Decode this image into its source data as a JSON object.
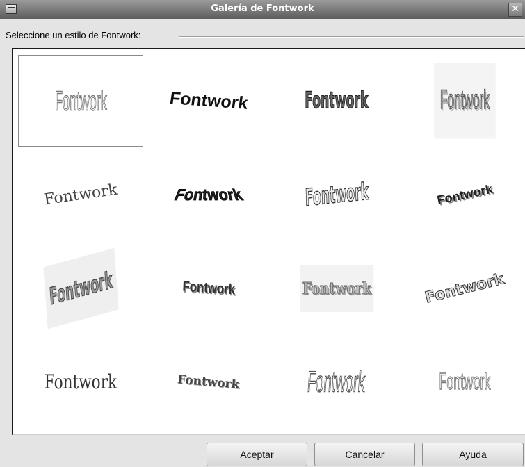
{
  "window": {
    "title": "Galería de Fontwork",
    "close_glyph": "✕",
    "icon": "window-menu-icon"
  },
  "section": {
    "label": "Seleccione un estilo de Fontwork:"
  },
  "gallery": {
    "selected_index": 0,
    "items": [
      {
        "text": "Fontwork"
      },
      {
        "text": "Fontwork"
      },
      {
        "text": "Fontwork"
      },
      {
        "text": "Fontwork"
      },
      {
        "text": "Fontwork"
      },
      {
        "text": "Fontwork"
      },
      {
        "text": "Fontwork"
      },
      {
        "text": "Fontwork"
      },
      {
        "text": "Fontwork"
      },
      {
        "text": "Fontwork"
      },
      {
        "text": "Fontwork"
      },
      {
        "text": "Fontwork"
      },
      {
        "text": "Fontwork"
      },
      {
        "text": "Fontwork"
      },
      {
        "text": "Fontwork"
      },
      {
        "text": "Fontwork"
      }
    ]
  },
  "buttons": {
    "ok": "Aceptar",
    "cancel": "Cancelar",
    "help_pre": "Ay",
    "help_mnemonic": "u",
    "help_post": "da"
  }
}
